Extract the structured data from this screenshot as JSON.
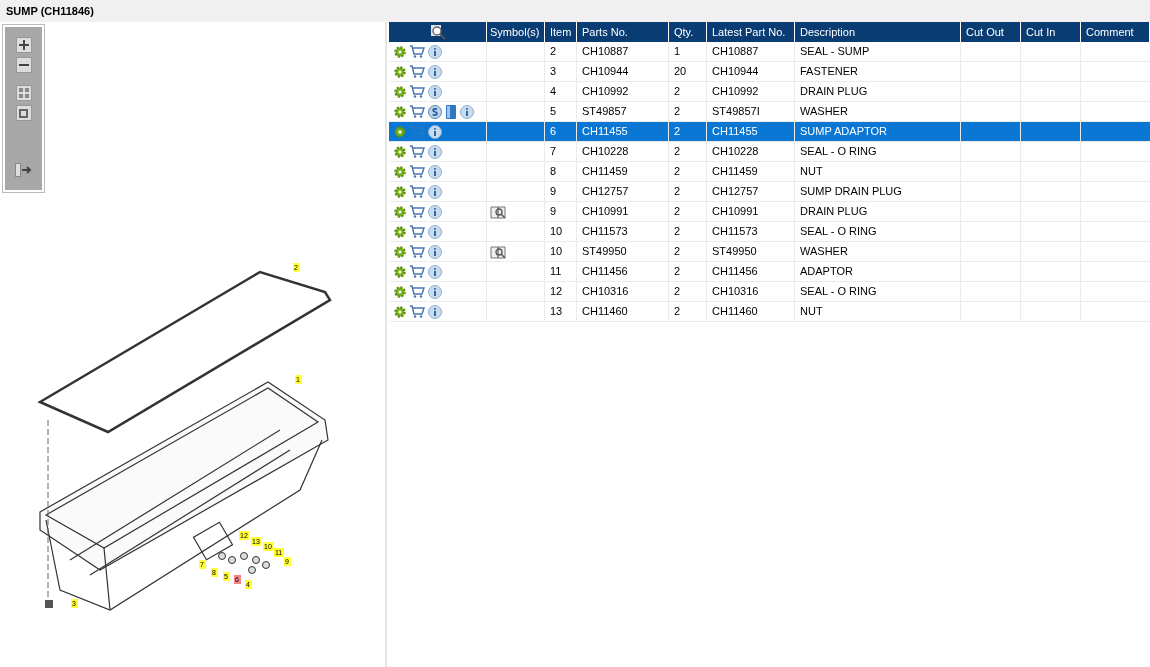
{
  "title": "SUMP (CH11846)",
  "callouts": [
    {
      "label": "2",
      "selected": false
    },
    {
      "label": "1",
      "selected": false
    },
    {
      "label": "12",
      "selected": false
    },
    {
      "label": "13",
      "selected": false
    },
    {
      "label": "10",
      "selected": false
    },
    {
      "label": "11",
      "selected": false
    },
    {
      "label": "9",
      "selected": false
    },
    {
      "label": "7",
      "selected": false
    },
    {
      "label": "8",
      "selected": false
    },
    {
      "label": "5",
      "selected": false
    },
    {
      "label": "6",
      "selected": true
    },
    {
      "label": "4",
      "selected": false
    },
    {
      "label": "3",
      "selected": false
    }
  ],
  "table": {
    "symbols_heading": "Symbol(s)",
    "columns": [
      "Item",
      "Parts No.",
      "Qty.",
      "Latest Part No.",
      "Description",
      "Cut Out",
      "Cut In",
      "Comment"
    ],
    "rows": [
      {
        "s_badge": false,
        "manual": false,
        "symbol": false,
        "selected": false,
        "cells": [
          "2",
          "CH10887",
          "1",
          "CH10887",
          "SEAL - SUMP"
        ]
      },
      {
        "s_badge": false,
        "manual": false,
        "symbol": false,
        "selected": false,
        "cells": [
          "3",
          "CH10944",
          "20",
          "CH10944",
          "FASTENER"
        ]
      },
      {
        "s_badge": false,
        "manual": false,
        "symbol": false,
        "selected": false,
        "cells": [
          "4",
          "CH10992",
          "2",
          "CH10992",
          "DRAIN PLUG"
        ]
      },
      {
        "s_badge": true,
        "manual": true,
        "symbol": false,
        "selected": false,
        "cells": [
          "5",
          "ST49857",
          "2",
          "ST49857I",
          "WASHER"
        ]
      },
      {
        "s_badge": false,
        "manual": false,
        "symbol": false,
        "selected": true,
        "cells": [
          "6",
          "CH11455",
          "2",
          "CH11455",
          "SUMP ADAPTOR"
        ]
      },
      {
        "s_badge": false,
        "manual": false,
        "symbol": false,
        "selected": false,
        "cells": [
          "7",
          "CH10228",
          "2",
          "CH10228",
          "SEAL - O RING"
        ]
      },
      {
        "s_badge": false,
        "manual": false,
        "symbol": false,
        "selected": false,
        "cells": [
          "8",
          "CH11459",
          "2",
          "CH11459",
          "NUT"
        ]
      },
      {
        "s_badge": false,
        "manual": false,
        "symbol": false,
        "selected": false,
        "cells": [
          "9",
          "CH12757",
          "2",
          "CH12757",
          "SUMP DRAIN PLUG"
        ]
      },
      {
        "s_badge": false,
        "manual": false,
        "symbol": true,
        "selected": false,
        "cells": [
          "9",
          "CH10991",
          "2",
          "CH10991",
          "DRAIN PLUG"
        ]
      },
      {
        "s_badge": false,
        "manual": false,
        "symbol": false,
        "selected": false,
        "cells": [
          "10",
          "CH11573",
          "2",
          "CH11573",
          "SEAL - O RING"
        ]
      },
      {
        "s_badge": false,
        "manual": false,
        "symbol": true,
        "selected": false,
        "cells": [
          "10",
          "ST49950",
          "2",
          "ST49950",
          "WASHER"
        ]
      },
      {
        "s_badge": false,
        "manual": false,
        "symbol": false,
        "selected": false,
        "cells": [
          "11",
          "CH11456",
          "2",
          "CH11456",
          "ADAPTOR"
        ]
      },
      {
        "s_badge": false,
        "manual": false,
        "symbol": false,
        "selected": false,
        "cells": [
          "12",
          "CH10316",
          "2",
          "CH10316",
          "SEAL - O RING"
        ]
      },
      {
        "s_badge": false,
        "manual": false,
        "symbol": false,
        "selected": false,
        "cells": [
          "13",
          "CH11460",
          "2",
          "CH11460",
          "NUT"
        ]
      }
    ]
  }
}
